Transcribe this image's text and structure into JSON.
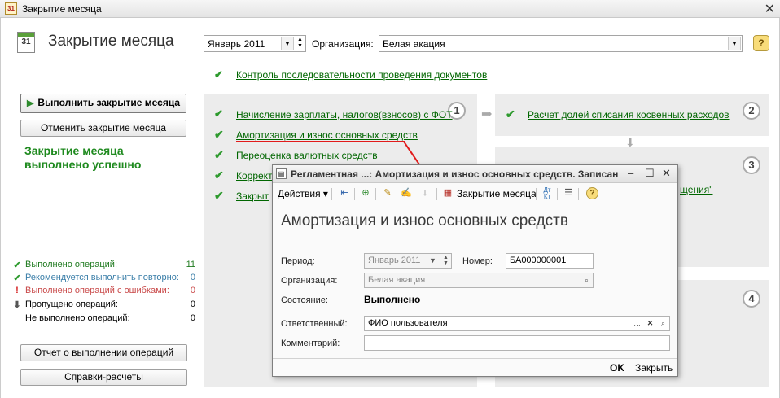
{
  "window": {
    "title": "Закрытие месяца"
  },
  "header": {
    "icon_day": "31",
    "title": "Закрытие месяца",
    "period_value": "Январь 2011",
    "org_label": "Организация:",
    "org_value": "Белая акация",
    "help": "?"
  },
  "control_link": "Контроль последовательности проведения документов",
  "left": {
    "run_button": "Выполнить закрытие месяца",
    "cancel_button": "Отменить закрытие месяца",
    "success_message": "Закрытие месяца выполнено успешно",
    "stats": [
      {
        "label": "Выполнено операций:",
        "count": "11",
        "color": "#1f7a1f",
        "icon": "check-icon",
        "glyph": "✔"
      },
      {
        "label": "Рекомендуется выполнить повторно:",
        "count": "0",
        "color": "#3a7ea8",
        "icon": "check-icon",
        "glyph": "✔"
      },
      {
        "label": "Выполнено операций с ошибками:",
        "count": "0",
        "color": "#c94a4a",
        "icon": "exclamation-icon",
        "glyph": "!"
      },
      {
        "label": "Пропущено операций:",
        "count": "0",
        "color": "#222222",
        "icon": "arrow-down-icon",
        "glyph": "⬇"
      },
      {
        "label": "Не выполнено операций:",
        "count": "0",
        "color": "#222222",
        "icon": "none",
        "glyph": ""
      }
    ],
    "report_button": "Отчет о выполнении операций",
    "calc_button": "Справки-расчеты"
  },
  "steps": {
    "s1": "1",
    "s2": "2",
    "s3": "3",
    "s4": "4",
    "panel1_ops": [
      "Начисление зарплаты, налогов(взносов) с ФОТ",
      "Амортизация и износ основных средств",
      "Переоценка валютных средств",
      "Коррект",
      "Закрыт"
    ],
    "panel2_op": "Расчет долей списания косвенных расходов",
    "panel3_partial": "щения\""
  },
  "dialog": {
    "title": "Регламентная ...: Амортизация и износ основных средств. Записан",
    "toolbar": {
      "actions": "Действия",
      "close_month": "Закрытие месяца"
    },
    "heading": "Амортизация и износ основных средств",
    "period_label": "Период:",
    "period_value": "Январь 2011",
    "number_label": "Номер:",
    "number_value": "БА000000001",
    "org_label": "Организация:",
    "org_value": "Белая акация",
    "state_label": "Состояние:",
    "state_value": "Выполнено",
    "resp_label": "Ответственный:",
    "resp_value": "ФИО пользователя",
    "comment_label": "Комментарий:",
    "comment_value": "",
    "ok": "OK",
    "close": "Закрыть"
  }
}
